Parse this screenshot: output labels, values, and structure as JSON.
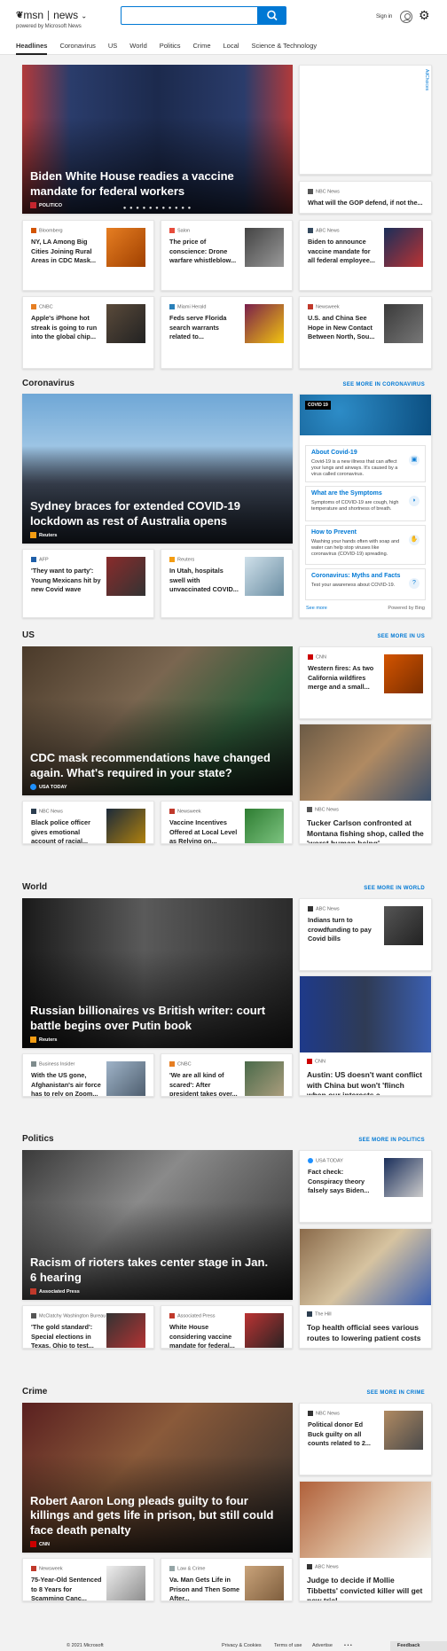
{
  "header": {
    "brand": "msn",
    "section": "news",
    "tagline": "powered by Microsoft News",
    "search": {
      "value": "",
      "placeholder": ""
    },
    "signin": "Sign in"
  },
  "nav": [
    "Headlines",
    "Coronavirus",
    "US",
    "World",
    "Politics",
    "Crime",
    "Local",
    "Science & Technology"
  ],
  "ad": {
    "label": "AdChoices"
  },
  "top": {
    "hero": {
      "title": "Biden White House readies a vaccine mandate for federal workers",
      "source": "POLITICO",
      "dots": "● ● ● ● ● ● ● ● ● ● ●"
    },
    "side": {
      "source": "NBC News",
      "title": "What will the GOP defend, if not the..."
    },
    "row1": [
      {
        "source": "Bloomberg",
        "title": "NY, LA Among Big Cities Joining Rural Areas in CDC Mask...",
        "color": "#d35400"
      },
      {
        "source": "Salon",
        "title": "The price of conscience: Drone warfare whistleblow...",
        "color": "#e74c3c"
      },
      {
        "source": "ABC News",
        "title": "Biden to announce vaccine mandate for all federal employee...",
        "color": "#34495e"
      }
    ],
    "row2": [
      {
        "source": "CNBC",
        "title": "Apple's iPhone hot streak is going to run into the global chip...",
        "color": "#e67e22"
      },
      {
        "source": "Miami Herald",
        "title": "Feds serve Florida search warrants related to...",
        "color": "#2980b9"
      },
      {
        "source": "Newsweek",
        "title": "U.S. and China See Hope in New Contact Between North, Sou...",
        "color": "#c0392b"
      }
    ]
  },
  "coronavirus": {
    "heading": "Coronavirus",
    "more": "SEE MORE IN CORONAVIRUS",
    "hero": {
      "title": "Sydney braces for extended COVID-19 lockdown as rest of Australia opens",
      "source": "Reuters"
    },
    "small": [
      {
        "source": "AFP",
        "title": "'They want to party': Young Mexicans hit by new Covid wave",
        "color": "#1f5fa8"
      },
      {
        "source": "Reuters",
        "title": "In Utah, hospitals swell with unvaccinated COVID...",
        "color": "#f39c12"
      }
    ],
    "info": {
      "tag": "COVID 19",
      "items": [
        {
          "title": "About Covid-19",
          "desc": "Covid-19 is a new illness that can affect your lungs and airways. It's caused by a virus called coronavirus."
        },
        {
          "title": "What are the Symptoms",
          "desc": "Symptoms of COVID-19 are cough, high temperature and shortness of breath."
        },
        {
          "title": "How to Prevent",
          "desc": "Washing your hands often with soap and water can help stop viruses like coronavirus (COVID-19) spreading."
        },
        {
          "title": "Coronavirus: Myths and Facts",
          "desc": "Test your awareness about COVID-19."
        }
      ],
      "see_more": "See more",
      "powered": "Powered by Bing"
    }
  },
  "us": {
    "heading": "US",
    "more": "SEE MORE IN US",
    "hero": {
      "title": "CDC mask recommendations have changed again. What's required in your state?",
      "source": "USA TODAY"
    },
    "side": {
      "source": "CNN",
      "title": "Western fires: As two California wildfires merge and a small..."
    },
    "tall": {
      "source": "NBC News",
      "title": "Tucker Carlson confronted at Montana fishing shop, called the 'worst human being'"
    },
    "small": [
      {
        "source": "NBC News",
        "title": "Black police officer gives emotional account of racial...",
        "color": "#2c3e50"
      },
      {
        "source": "Newsweek",
        "title": "Vaccine Incentives Offered at Local Level as Relying on...",
        "color": "#c0392b"
      }
    ]
  },
  "world": {
    "heading": "World",
    "more": "SEE MORE IN WORLD",
    "hero": {
      "title": "Russian billionaires vs British writer: court battle begins over Putin book",
      "source": "Reuters"
    },
    "side": {
      "source": "ABC News",
      "title": "Indians turn to crowdfunding to pay Covid bills"
    },
    "tall": {
      "source": "CNN",
      "title": "Austin: US doesn't want conflict with China but won't 'flinch when our interests a..."
    },
    "small": [
      {
        "source": "Business Insider",
        "title": "With the US gone, Afghanistan's air force has to rely on Zoom...",
        "color": "#7f8c8d"
      },
      {
        "source": "CNBC",
        "title": "'We are all kind of scared': After president takes over...",
        "color": "#e67e22"
      }
    ]
  },
  "politics": {
    "heading": "Politics",
    "more": "SEE MORE IN POLITICS",
    "hero": {
      "title": "Racism of rioters takes center stage in Jan. 6 hearing",
      "source": "Associated Press"
    },
    "side": {
      "source": "USA TODAY",
      "title": "Fact check: Conspiracy theory falsely says Biden..."
    },
    "tall": {
      "source": "The Hill",
      "title": "Top health official sees various routes to lowering patient costs"
    },
    "small": [
      {
        "source": "McClatchy Washington Bureau",
        "title": "'The gold standard': Special elections in Texas, Ohio to test...",
        "color": "#555"
      },
      {
        "source": "Associated Press",
        "title": "White House considering vaccine mandate for federal...",
        "color": "#c0392b"
      }
    ]
  },
  "crime": {
    "heading": "Crime",
    "more": "SEE MORE IN CRIME",
    "hero": {
      "title": "Robert Aaron Long pleads guilty to four killings and gets life in prison, but still could face death penalty",
      "source": "CNN"
    },
    "side": {
      "source": "NBC News",
      "title": "Political donor Ed Buck guilty on all counts related to 2..."
    },
    "tall": {
      "source": "ABC News",
      "title": "Judge to decide if Mollie Tibbetts' convicted killer will get new trial"
    },
    "small": [
      {
        "source": "Newsweek",
        "title": "75-Year-Old Sentenced to 8 Years for Scamming Canc...",
        "color": "#c0392b"
      },
      {
        "source": "Law & Crime",
        "title": "Va. Man Gets Life in Prison and Then Some After...",
        "color": "#95a5a6"
      }
    ]
  },
  "footer": {
    "copyright": "© 2021 Microsoft",
    "privacy": "Privacy & Cookies",
    "terms": "Terms of use",
    "advertise": "Advertise",
    "dots": "• • •",
    "feedback": "Feedback"
  }
}
